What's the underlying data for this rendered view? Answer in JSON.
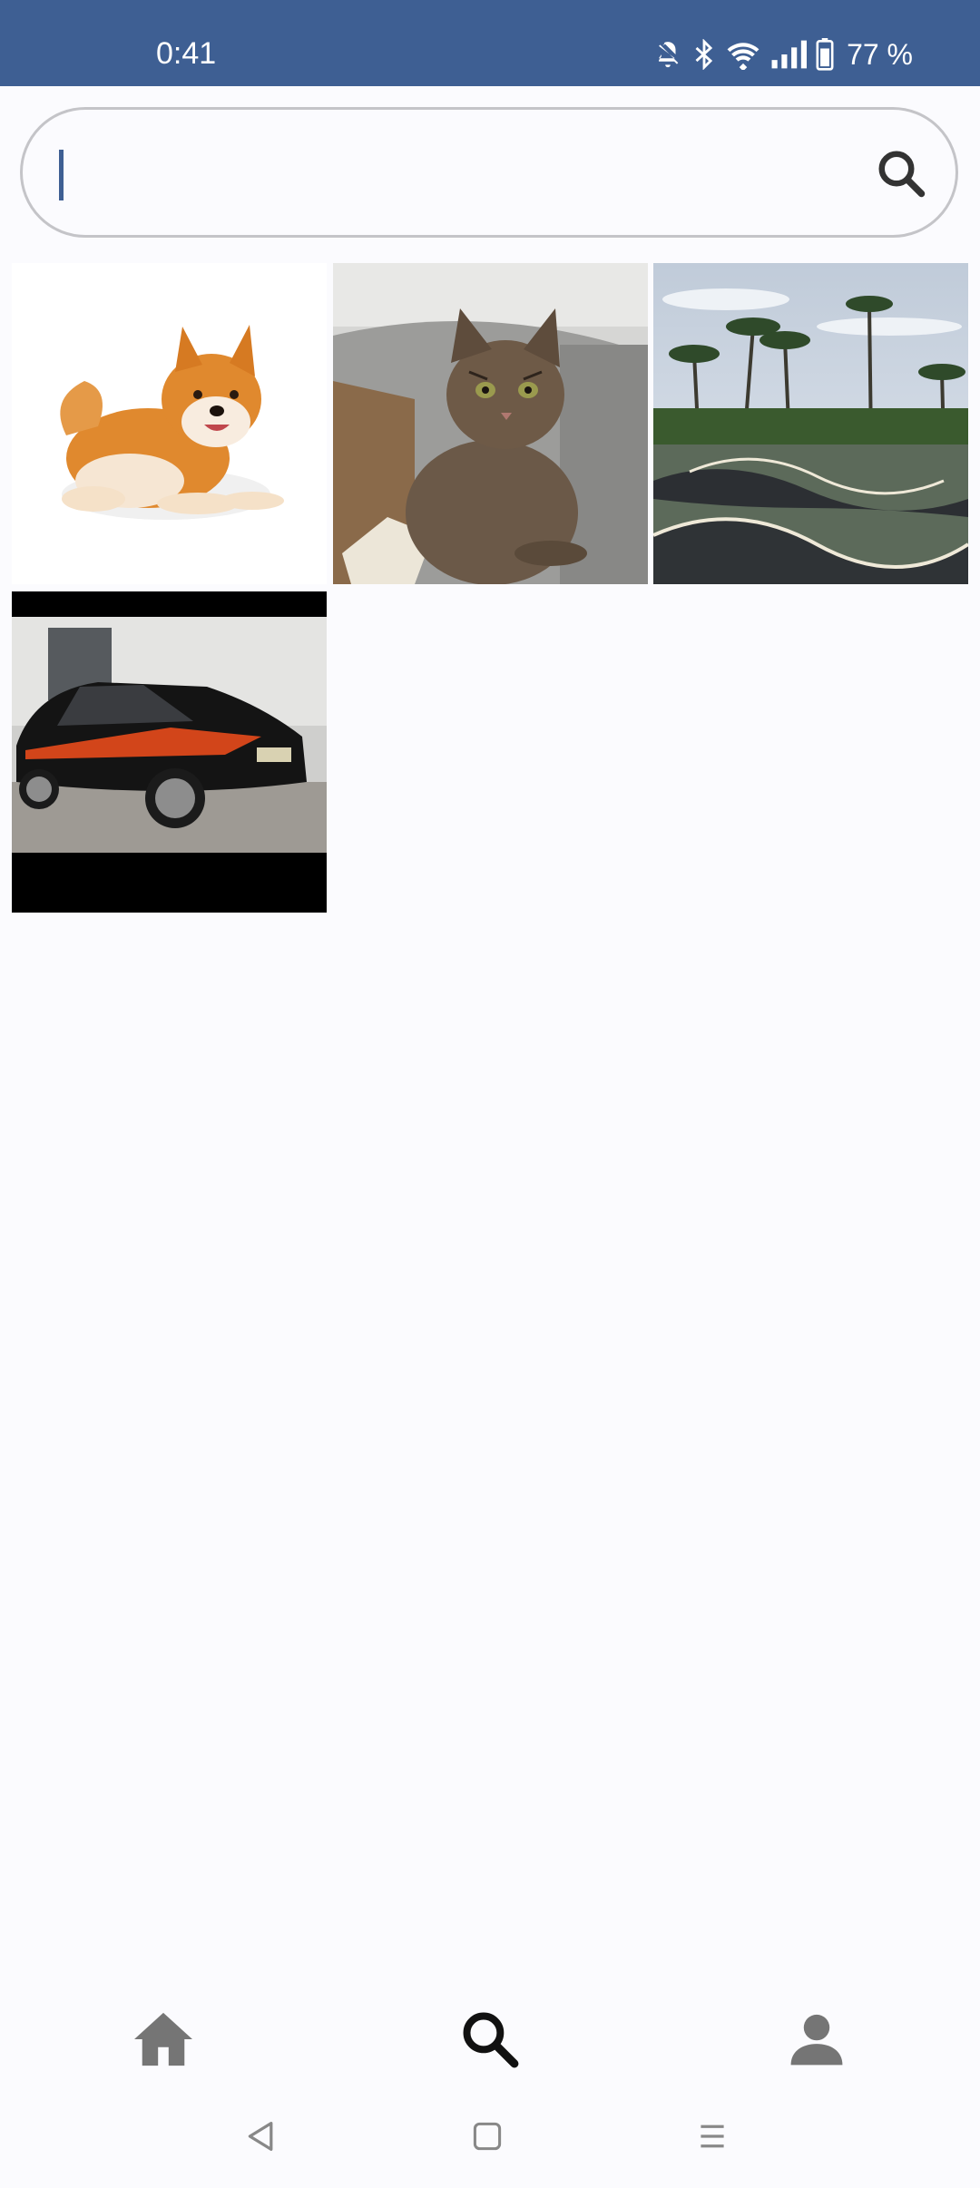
{
  "status_bar": {
    "time": "0:41",
    "battery_percent": "77 %",
    "icons": [
      "mute-icon",
      "bluetooth-icon",
      "wifi-icon",
      "signal-icon",
      "battery-icon"
    ],
    "background_color": "#3e5f93"
  },
  "search": {
    "value": "",
    "placeholder": "",
    "icon": "search-icon"
  },
  "results": [
    {
      "subject": "shiba-inu-dog"
    },
    {
      "subject": "tabby-cat"
    },
    {
      "subject": "pump-track-palm-trees"
    },
    {
      "subject": "black-car-orange-stripe"
    }
  ],
  "bottom_nav": {
    "items": [
      {
        "icon": "home-icon",
        "active": false
      },
      {
        "icon": "search-icon",
        "active": true
      },
      {
        "icon": "profile-icon",
        "active": false
      }
    ]
  },
  "system_nav": {
    "items": [
      "back-icon",
      "home-square-icon",
      "recents-icon"
    ]
  }
}
